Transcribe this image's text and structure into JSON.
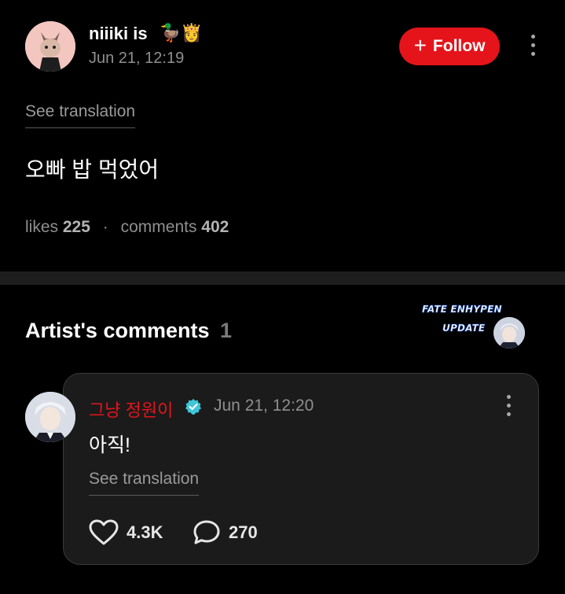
{
  "post": {
    "author": "niiiki is",
    "author_emojis": "🦆👸",
    "time": "Jun 21, 12:19",
    "follow_label": "Follow",
    "see_translation": "See translation",
    "text": "오빠 밥 먹었어",
    "likes_label": "likes",
    "likes_count": "225",
    "separator": "·",
    "comments_label": "comments",
    "comments_count": "402"
  },
  "section": {
    "title": "Artist's comments",
    "count": "1"
  },
  "watermark": {
    "line1": "FATE ENHYPEN",
    "line2": "UPDATE"
  },
  "comment": {
    "author": "그냥 정원이",
    "time": "Jun 21, 12:20",
    "text": "아직!",
    "see_translation": "See translation",
    "likes": "4.3K",
    "replies": "270"
  },
  "icons": {
    "follow": "plus-icon",
    "more": "more-vertical-icon",
    "verified": "verified-badge-icon",
    "like": "heart-icon",
    "reply": "speech-bubble-icon"
  },
  "colors": {
    "accent": "#e5141b",
    "background": "#000000",
    "card": "#1b1b1b",
    "verified": "#3ec6d8"
  }
}
